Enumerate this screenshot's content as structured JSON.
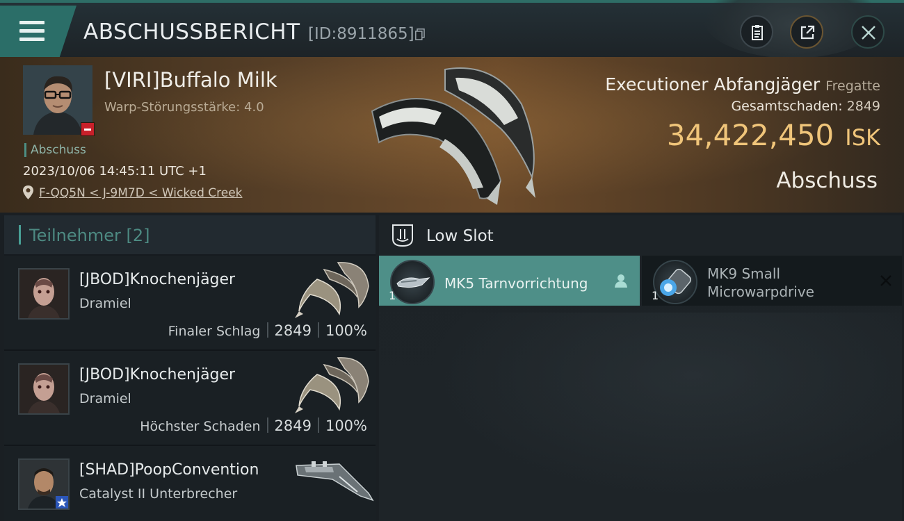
{
  "header": {
    "title": "ABSCHUSSBERICHT",
    "id_label": "[ID:8911865]"
  },
  "victim": {
    "name": "[VIRI]Buffalo Milk",
    "warp": "Warp-Störungsstärke: 4.0",
    "kill_tag": "Abschuss",
    "datetime": "2023/10/06 14:45:11 UTC +1",
    "location": "F-QQ5N < J-9M7D < Wicked Creek",
    "ship": "Executioner Abfangjäger",
    "ship_class": "Fregatte",
    "damage_label": "Gesamtschaden:",
    "damage_value": "2849",
    "isk_value": "34,422,450",
    "isk_unit": "ISK",
    "result": "Abschuss"
  },
  "participants": {
    "title": "Teilnehmer",
    "count": "[2]",
    "items": [
      {
        "name": "[JBOD]Knochenjäger",
        "ship": "Dramiel",
        "role": "Finaler Schlag",
        "damage": "2849",
        "percent": "100%"
      },
      {
        "name": "[JBOD]Knochenjäger",
        "ship": "Dramiel",
        "role": "Höchster Schaden",
        "damage": "2849",
        "percent": "100%"
      },
      {
        "name": "[SHAD]PoopConvention",
        "ship": "Catalyst II Unterbrecher"
      }
    ]
  },
  "slots": {
    "title": "Low Slot",
    "items": [
      {
        "name": "MK5 Tarnvorrichtung",
        "qty": "1"
      },
      {
        "name_line1": "MK9 Small",
        "name_line2": "Microwarpdrive",
        "qty": "1"
      }
    ]
  },
  "colors": {
    "accent": "#4e8f88",
    "isk": "#f0c57a",
    "badge": "#c8202a"
  },
  "icons": [
    "menu-icon",
    "copy-icon",
    "clipboard-icon",
    "share-icon",
    "close-icon",
    "location-pin-icon",
    "low-slot-icon",
    "pilot-icon",
    "remove-icon"
  ]
}
